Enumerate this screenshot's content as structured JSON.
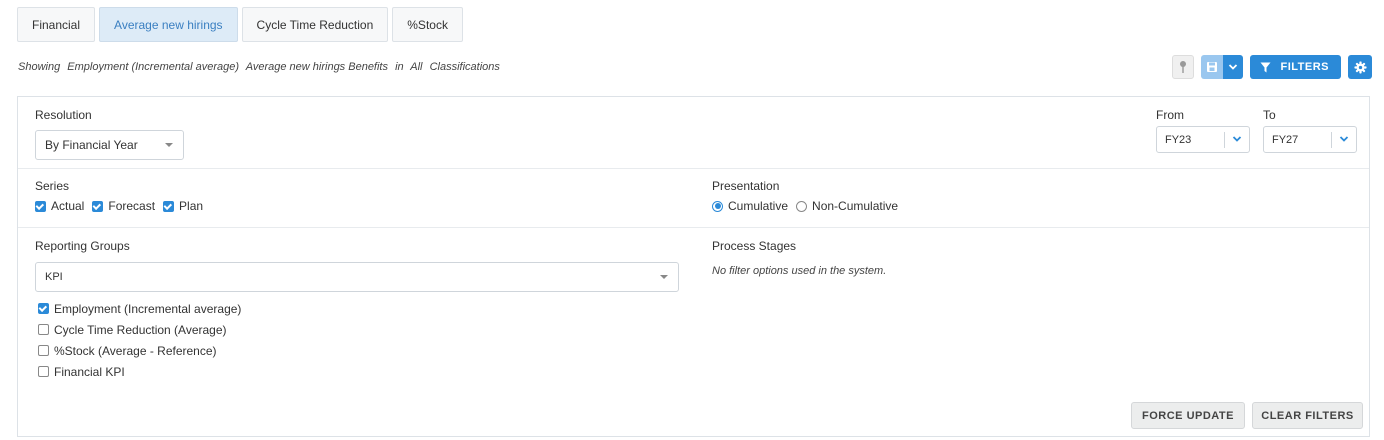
{
  "tabs": [
    {
      "label": "Financial",
      "active": false
    },
    {
      "label": "Average new hirings",
      "active": true
    },
    {
      "label": "Cycle Time Reduction",
      "active": false
    },
    {
      "label": "%Stock",
      "active": false
    }
  ],
  "showing": {
    "prefix": "Showing",
    "measure": "Employment (Incremental average)",
    "metric": "Average new hirings Benefits",
    "in_word": "in",
    "scope": "All",
    "suffix": "Classifications"
  },
  "toolbar": {
    "filters_label": "FILTERS",
    "icons": [
      "pin-icon",
      "save-icon",
      "chevron-down-icon",
      "funnel-icon",
      "gear-icon"
    ],
    "accent_color": "#2b8ad8"
  },
  "resolution": {
    "label": "Resolution",
    "value": "By Financial Year"
  },
  "range": {
    "from_label": "From",
    "from_value": "FY23",
    "to_label": "To",
    "to_value": "FY27"
  },
  "series": {
    "label": "Series",
    "items": [
      {
        "label": "Actual",
        "checked": true
      },
      {
        "label": "Forecast",
        "checked": true
      },
      {
        "label": "Plan",
        "checked": true
      }
    ]
  },
  "presentation": {
    "label": "Presentation",
    "options": [
      {
        "label": "Cumulative",
        "selected": true
      },
      {
        "label": "Non-Cumulative",
        "selected": false
      }
    ]
  },
  "reporting_groups": {
    "label": "Reporting Groups",
    "select_value": "KPI",
    "items": [
      {
        "label": "Employment (Incremental average)",
        "checked": true
      },
      {
        "label": "Cycle Time Reduction (Average)",
        "checked": false
      },
      {
        "label": "%Stock (Average - Reference)",
        "checked": false
      },
      {
        "label": "Financial KPI",
        "checked": false
      }
    ]
  },
  "process_stages": {
    "label": "Process Stages",
    "empty_text": "No filter options used in the system."
  },
  "actions": {
    "force_update": "FORCE UPDATE",
    "clear_filters": "CLEAR FILTERS"
  }
}
